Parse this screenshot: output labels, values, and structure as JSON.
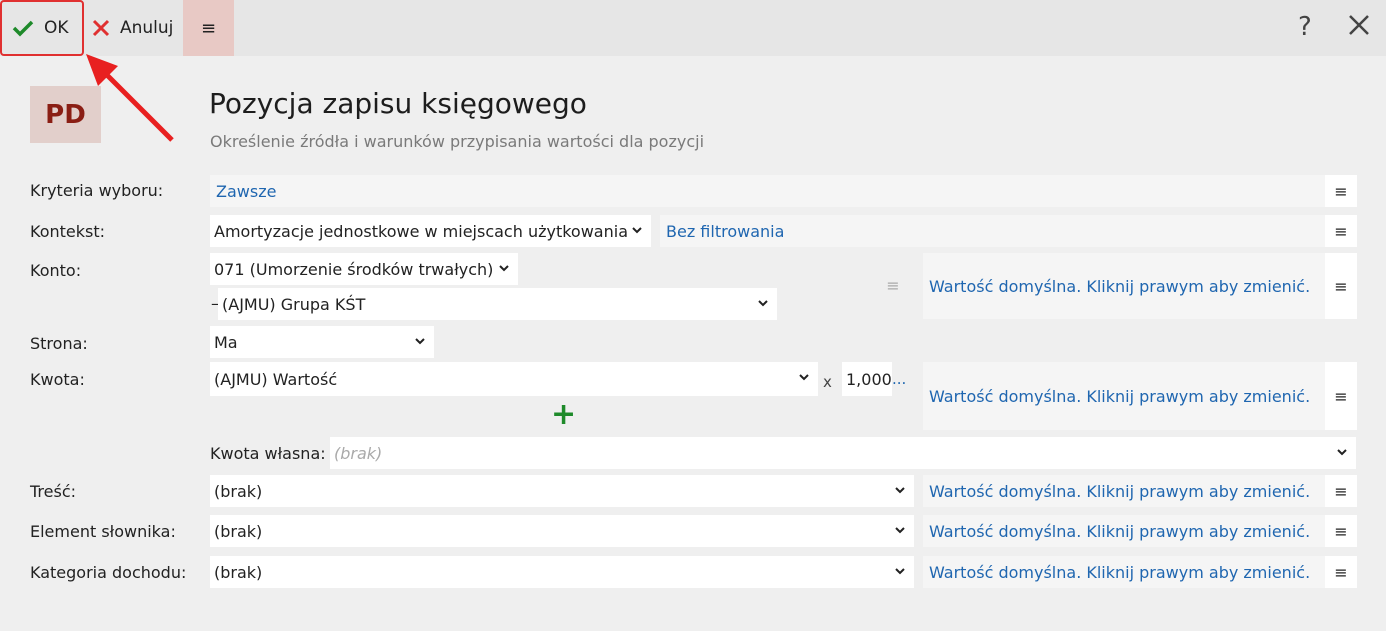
{
  "toolbar": {
    "ok_label": "OK",
    "cancel_label": "Anuluj",
    "menu_glyph": "≡",
    "help_glyph": "?"
  },
  "header": {
    "logo": "PD",
    "title": "Pozycja zapisu księgowego",
    "subtitle": "Określenie źródła i warunków przypisania wartości dla pozycji"
  },
  "form": {
    "kryteria": {
      "label": "Kryteria wyboru:",
      "value": "Zawsze"
    },
    "kontekst": {
      "label": "Kontekst:",
      "value": "Amortyzacje jednostkowe w miejscach użytkowania",
      "filter": "Bez filtrowania"
    },
    "konto": {
      "label": "Konto:",
      "value": "071 (Umorzenie środków trwałych)",
      "sub_dash": "–",
      "sub_value": "(AJMU) Grupa KŚT",
      "default_text": "Wartość domyślna. Kliknij prawym aby zmienić."
    },
    "strona": {
      "label": "Strona:",
      "value": "Ma"
    },
    "kwota": {
      "label": "Kwota:",
      "value": "(AJMU) Wartość",
      "multiplier_x": "x",
      "multiplier": "1,000",
      "multiplier_more": "...",
      "default_text": "Wartość domyślna. Kliknij prawym aby zmienić."
    },
    "kwota_wlasna": {
      "label": "Kwota własna:",
      "placeholder": "(brak)"
    },
    "tresc": {
      "label": "Treść:",
      "value": "(brak)",
      "default_text": "Wartość domyślna. Kliknij prawym aby zmienić."
    },
    "element": {
      "label": "Element słownika:",
      "value": "(brak)",
      "default_text": "Wartość domyślna. Kliknij prawym aby zmienić."
    },
    "kategoria": {
      "label": "Kategoria dochodu:",
      "value": "(brak)",
      "default_text": "Wartość domyślna. Kliknij prawym aby zmienić."
    },
    "menu_glyph": "≡",
    "plus_glyph": "+"
  },
  "colors": {
    "accent_link": "#1f66b0",
    "ok_green": "#1e8a2a",
    "cancel_red": "#e03030",
    "logo_bg": "#e2cfcb",
    "logo_fg": "#8a1e14"
  }
}
